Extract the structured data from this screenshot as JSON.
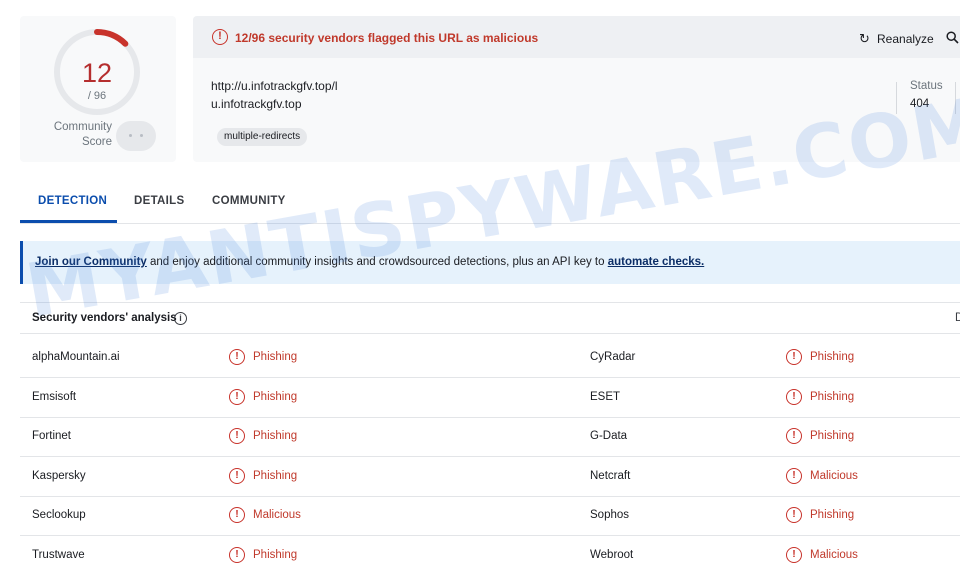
{
  "score": {
    "detected": "12",
    "total": "/ 96",
    "community_label_line1": "Community",
    "community_label_line2": "Score",
    "detection_fraction": 0.125
  },
  "header": {
    "flag_text": "12/96 security vendors flagged this URL as malicious",
    "reanalyze_label": "Reanalyze",
    "url": "http://u.infotrackgfv.top/l",
    "domain": "u.infotrackgfv.top",
    "tag": "multiple-redirects",
    "status_label": "Status",
    "status_value": "404"
  },
  "tabs": [
    {
      "label": "DETECTION",
      "active": true
    },
    {
      "label": "DETAILS",
      "active": false
    },
    {
      "label": "COMMUNITY",
      "active": false
    }
  ],
  "banner": {
    "link1": "Join our Community",
    "middle": " and enjoy additional community insights and crowdsourced detections, plus an API key to ",
    "link2": "automate checks."
  },
  "vendors": {
    "title": "Security vendors' analysis",
    "right_header_fragment": "D",
    "rows": [
      {
        "left_name": "alphaMountain.ai",
        "left_result": "Phishing",
        "right_name": "CyRadar",
        "right_result": "Phishing"
      },
      {
        "left_name": "Emsisoft",
        "left_result": "Phishing",
        "right_name": "ESET",
        "right_result": "Phishing"
      },
      {
        "left_name": "Fortinet",
        "left_result": "Phishing",
        "right_name": "G-Data",
        "right_result": "Phishing"
      },
      {
        "left_name": "Kaspersky",
        "left_result": "Phishing",
        "right_name": "Netcraft",
        "right_result": "Malicious"
      },
      {
        "left_name": "Seclookup",
        "left_result": "Malicious",
        "right_name": "Sophos",
        "right_result": "Phishing"
      },
      {
        "left_name": "Trustwave",
        "left_result": "Phishing",
        "right_name": "Webroot",
        "right_result": "Malicious"
      }
    ]
  },
  "watermark": "MYANTISPYWARE.COM",
  "icons": {
    "alert": "alert-circle-icon",
    "reanalyze": "refresh-icon",
    "search": "search-icon",
    "info": "info-icon"
  },
  "colors": {
    "malicious_red": "#c0392b",
    "accent_blue": "#0b4dad",
    "banner_bg": "#e6f2fc"
  }
}
